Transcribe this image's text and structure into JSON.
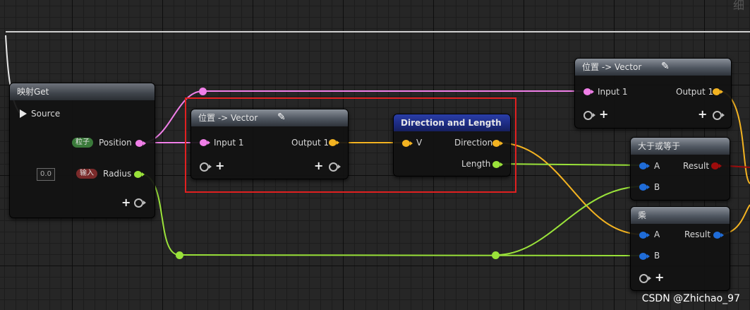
{
  "editor": {
    "title_fragment": "细",
    "watermark": "CSDN @Zhichao_97"
  },
  "nodes": {
    "map_get": {
      "title": "映射Get",
      "source_label": "Source",
      "position_tag": "粒子",
      "position_label": "Position",
      "radius_tag": "输入",
      "radius_label": "Radius",
      "radius_value": "0.0"
    },
    "pos_to_vector_mid": {
      "title": "位置 -> Vector",
      "input_label": "Input 1",
      "output_label": "Output 1"
    },
    "direction_length": {
      "title": "Direction and Length",
      "input_label": "V",
      "direction_label": "Direction",
      "length_label": "Length"
    },
    "pos_to_vector_top": {
      "title": "位置 -> Vector",
      "input_label": "Input 1",
      "output_label": "Output 1"
    },
    "greater_equal": {
      "title": "大于或等于",
      "a_label": "A",
      "b_label": "B",
      "result_label": "Result"
    },
    "multiply": {
      "title": "乘",
      "a_label": "A",
      "b_label": "B",
      "result_label": "Result"
    }
  },
  "colors": {
    "position_pin": "#f07fe8",
    "vector_pin": "#f3b321",
    "float_pin": "#9ae23a",
    "float_pin_dark": "#1f6cd8",
    "bool_pin": "#9d0c0c",
    "highlight": "#e02020"
  },
  "icons": [
    "pencil-icon",
    "plus-icon",
    "exec-pin-icon"
  ]
}
